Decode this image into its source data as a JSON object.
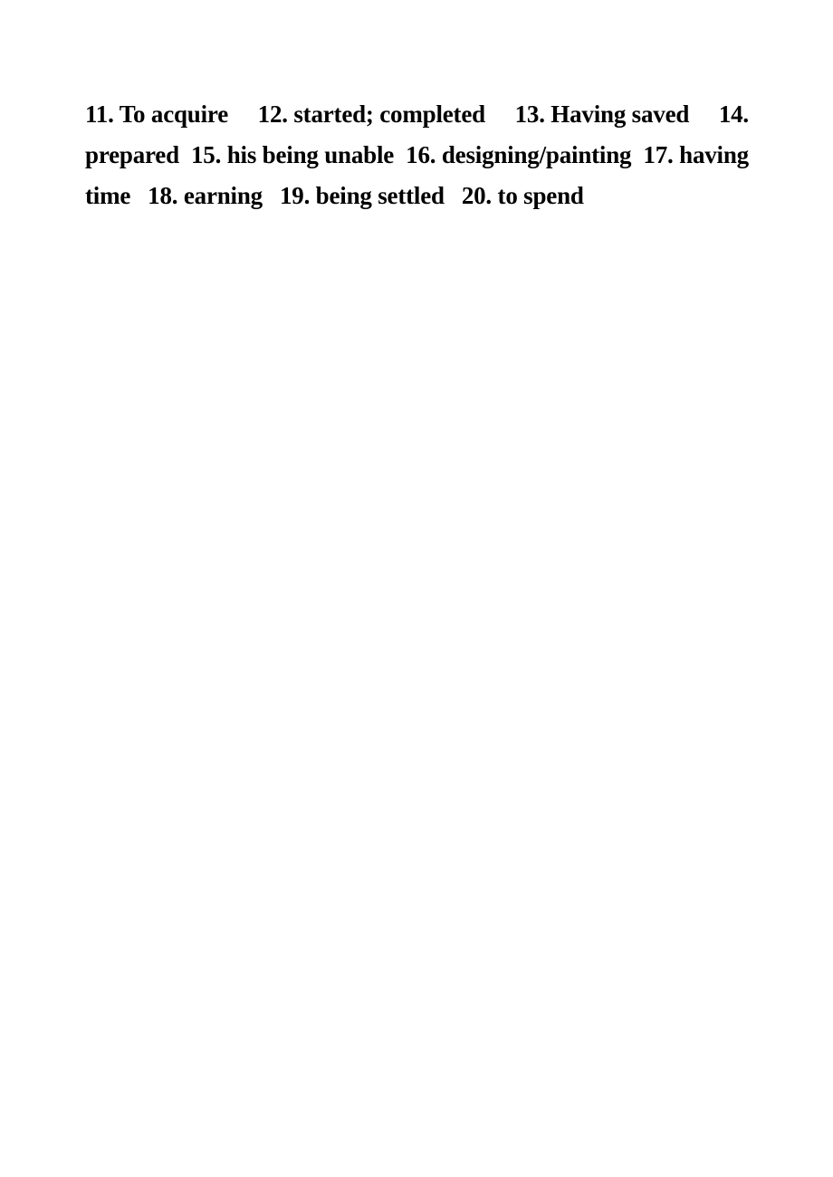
{
  "document": {
    "type": "answer-key",
    "background_color": "#ffffff",
    "text_color": "#000000",
    "lines": [
      {
        "id": "line-1",
        "justified": true,
        "segments": [
          "11. To acquire",
          "12. started; completed",
          "13. Having saved",
          "14."
        ]
      },
      {
        "id": "line-2",
        "justified": true,
        "segments": [
          "prepared",
          "15. his being unable",
          "16. designing/painting",
          "17. having"
        ]
      },
      {
        "id": "line-3",
        "justified": false,
        "segments": [
          "time",
          "18. earning",
          "19. being settled",
          "20. to spend"
        ]
      }
    ]
  },
  "answers": [
    {
      "number": "11.",
      "text": "To acquire"
    },
    {
      "number": "12.",
      "text": "started; completed"
    },
    {
      "number": "13.",
      "text": "Having saved"
    },
    {
      "number": "14.",
      "text": "prepared"
    },
    {
      "number": "15.",
      "text": "his being unable"
    },
    {
      "number": "16.",
      "text": "designing/painting"
    },
    {
      "number": "17.",
      "text": "having time"
    },
    {
      "number": "18.",
      "text": "earning"
    },
    {
      "number": "19.",
      "text": "being settled"
    },
    {
      "number": "20.",
      "text": "to spend"
    }
  ],
  "line1": {
    "seg1": "11. To  acquire",
    "seg2": "12. started;  completed",
    "seg3": "13. Having  saved",
    "seg4": "14."
  },
  "line2": {
    "seg1": "prepared",
    "seg2": "15. his being unable",
    "seg3": "16. designing/painting",
    "seg4": "17. having"
  },
  "line3": {
    "seg1": "time",
    "seg2": "18. earning",
    "seg3": "19. being settled",
    "seg4": "20. to spend"
  }
}
